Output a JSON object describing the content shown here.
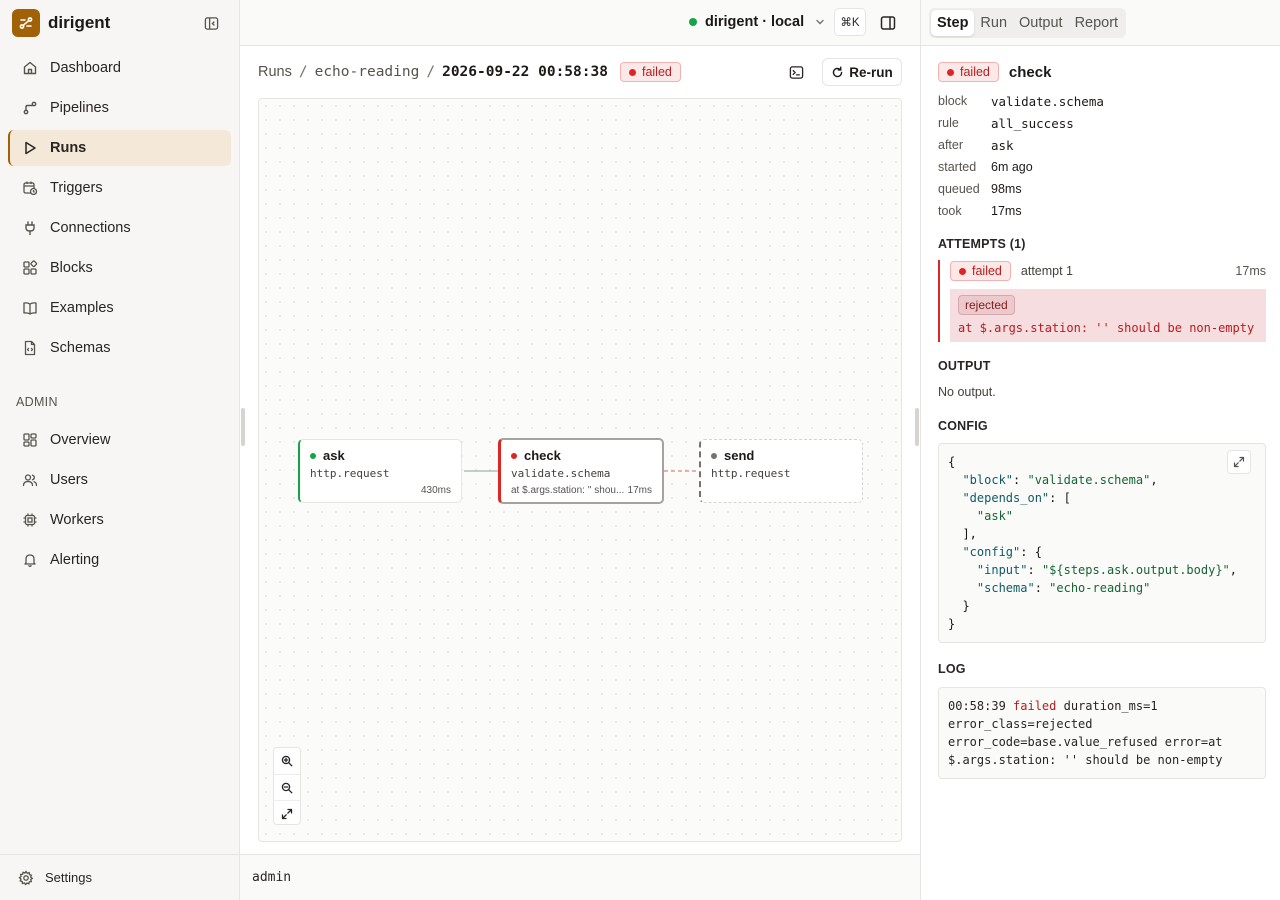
{
  "app": {
    "name": "dirigent"
  },
  "sidebar": {
    "items": [
      {
        "label": "Dashboard",
        "icon": "home-icon"
      },
      {
        "label": "Pipelines",
        "icon": "pipeline-icon"
      },
      {
        "label": "Runs",
        "icon": "play-icon"
      },
      {
        "label": "Triggers",
        "icon": "calendar-clock-icon"
      },
      {
        "label": "Connections",
        "icon": "plug-icon"
      },
      {
        "label": "Blocks",
        "icon": "blocks-icon"
      },
      {
        "label": "Examples",
        "icon": "book-icon"
      },
      {
        "label": "Schemas",
        "icon": "file-code-icon"
      }
    ],
    "active": "Runs",
    "admin_label": "ADMIN",
    "admin_items": [
      {
        "label": "Overview",
        "icon": "grid-icon"
      },
      {
        "label": "Users",
        "icon": "users-icon"
      },
      {
        "label": "Workers",
        "icon": "cpu-icon"
      },
      {
        "label": "Alerting",
        "icon": "bell-icon"
      }
    ],
    "footer": {
      "label": "Settings",
      "icon": "gear-icon"
    }
  },
  "topbar": {
    "environment": "dirigent · local",
    "env_status_color": "#16a34a",
    "shortcut": "⌘K"
  },
  "breadcrumb": {
    "root": "Runs",
    "pipeline": "echo-reading",
    "run": "2026-09-22 00:58:38",
    "status": "failed"
  },
  "actions": {
    "rerun_label": "Re-run"
  },
  "graph": {
    "nodes": [
      {
        "name": "ask",
        "block": "http.request",
        "duration": "430ms",
        "status": "ok",
        "error": ""
      },
      {
        "name": "check",
        "block": "validate.schema",
        "duration": "17ms",
        "status": "failed",
        "error": "at $.args.station: '' shou..."
      },
      {
        "name": "send",
        "block": "http.request",
        "duration": "",
        "status": "pending",
        "error": ""
      }
    ]
  },
  "statusbar": {
    "user": "admin"
  },
  "panel": {
    "tabs": [
      "Step",
      "Run",
      "Output",
      "Report"
    ],
    "active_tab": "Step",
    "step": {
      "status": "failed",
      "name": "check",
      "fields": [
        {
          "key": "block",
          "value": "validate.schema"
        },
        {
          "key": "rule",
          "value": "all_success"
        },
        {
          "key": "after",
          "value": "ask"
        },
        {
          "key": "started",
          "value": "6m ago"
        },
        {
          "key": "queued",
          "value": "98ms"
        },
        {
          "key": "took",
          "value": "17ms"
        }
      ]
    },
    "attempts": {
      "heading": "ATTEMPTS (1)",
      "items": [
        {
          "status": "failed",
          "label": "attempt 1",
          "duration": "17ms",
          "error_class": "rejected",
          "message": "at $.args.station: '' should be non-empty"
        }
      ]
    },
    "output": {
      "heading": "OUTPUT",
      "empty": "No output."
    },
    "config": {
      "heading": "CONFIG",
      "block_key": "\"block\"",
      "block_val": "\"validate.schema\"",
      "depends_key": "\"depends_on\"",
      "depends_item": "\"ask\"",
      "config_key": "\"config\"",
      "input_key": "\"input\"",
      "input_val": "\"${steps.ask.output.body}\"",
      "schema_key": "\"schema\"",
      "schema_val": "\"echo-reading\""
    },
    "log": {
      "heading": "LOG",
      "time": "00:58:39",
      "level": "failed",
      "rest_1": "duration_ms=1",
      "line_2": "error_class=rejected",
      "line_3": "error_code=base.value_refused error=at",
      "line_4": "$.args.station: '' should be non-empty"
    }
  },
  "colors": {
    "brand": "#a16207",
    "failed": "#dc2626",
    "ok": "#16a34a",
    "active_nav_bg": "#f4e9d9"
  }
}
